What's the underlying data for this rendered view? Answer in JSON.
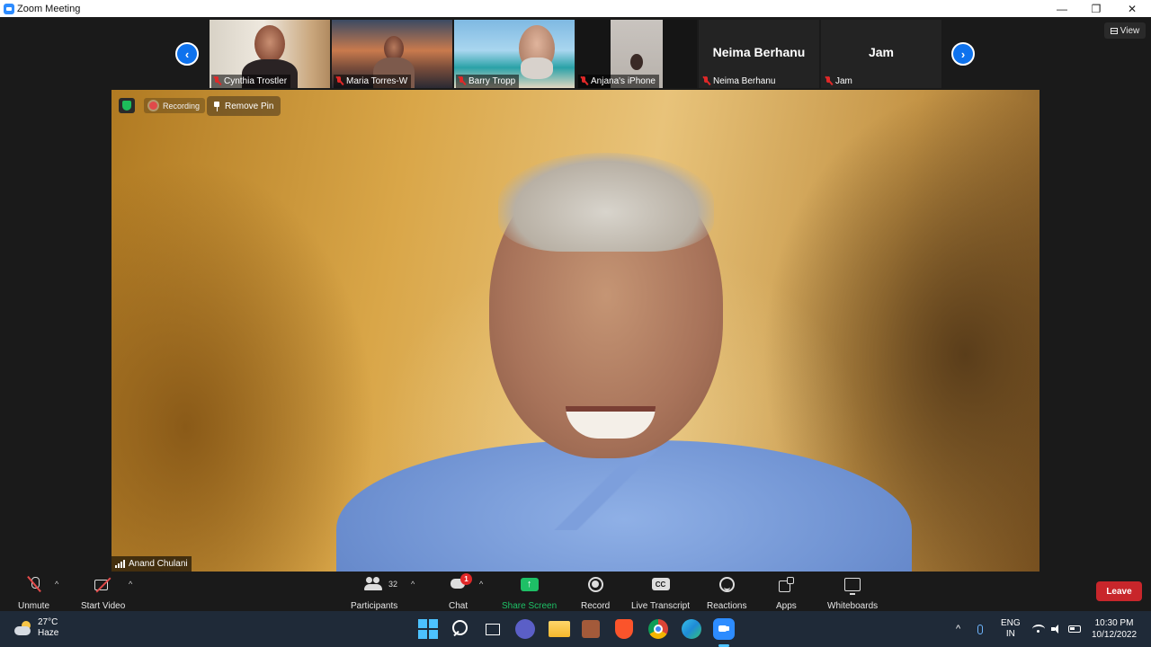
{
  "window": {
    "title": "Zoom Meeting",
    "minimize": "—",
    "maximize": "❐",
    "close": "✕"
  },
  "view": {
    "label": "View"
  },
  "strip": {
    "prev": "‹",
    "next": "›",
    "participants": [
      {
        "name": "Cynthia Trostler",
        "muted": true
      },
      {
        "name": "Maria Torres-W",
        "muted": true
      },
      {
        "name": "Barry Tropp",
        "muted": true
      },
      {
        "name": "Anjana's iPhone",
        "muted": true
      },
      {
        "name": "Neima Berhanu",
        "display": "Neima Berhanu",
        "muted": true
      },
      {
        "name": "Jam",
        "display": "Jam",
        "muted": true
      }
    ]
  },
  "main_video": {
    "recording_label": "Recording",
    "remove_pin_label": "Remove Pin",
    "speaker_name": "Anand Chulani"
  },
  "toolbar": {
    "unmute": "Unmute",
    "start_video": "Start Video",
    "participants": "Participants",
    "participant_count": "32",
    "chat": "Chat",
    "chat_unread": "1",
    "share_screen": "Share Screen",
    "share_glyph": "↑",
    "record": "Record",
    "live_transcript": "Live Transcript",
    "cc_glyph": "CC",
    "reactions": "Reactions",
    "apps": "Apps",
    "whiteboards": "Whiteboards",
    "leave": "Leave",
    "caret": "^"
  },
  "taskbar": {
    "temperature": "27°C",
    "weather": "Haze",
    "tray_up": "^",
    "lang_1": "ENG",
    "lang_2": "IN",
    "time": "10:30 PM",
    "date": "10/12/2022"
  },
  "colors": {
    "zoom_blue": "#0e72ed",
    "share_green": "#1ec066",
    "leave_red": "#c8262b",
    "muted_red": "#e02828"
  }
}
